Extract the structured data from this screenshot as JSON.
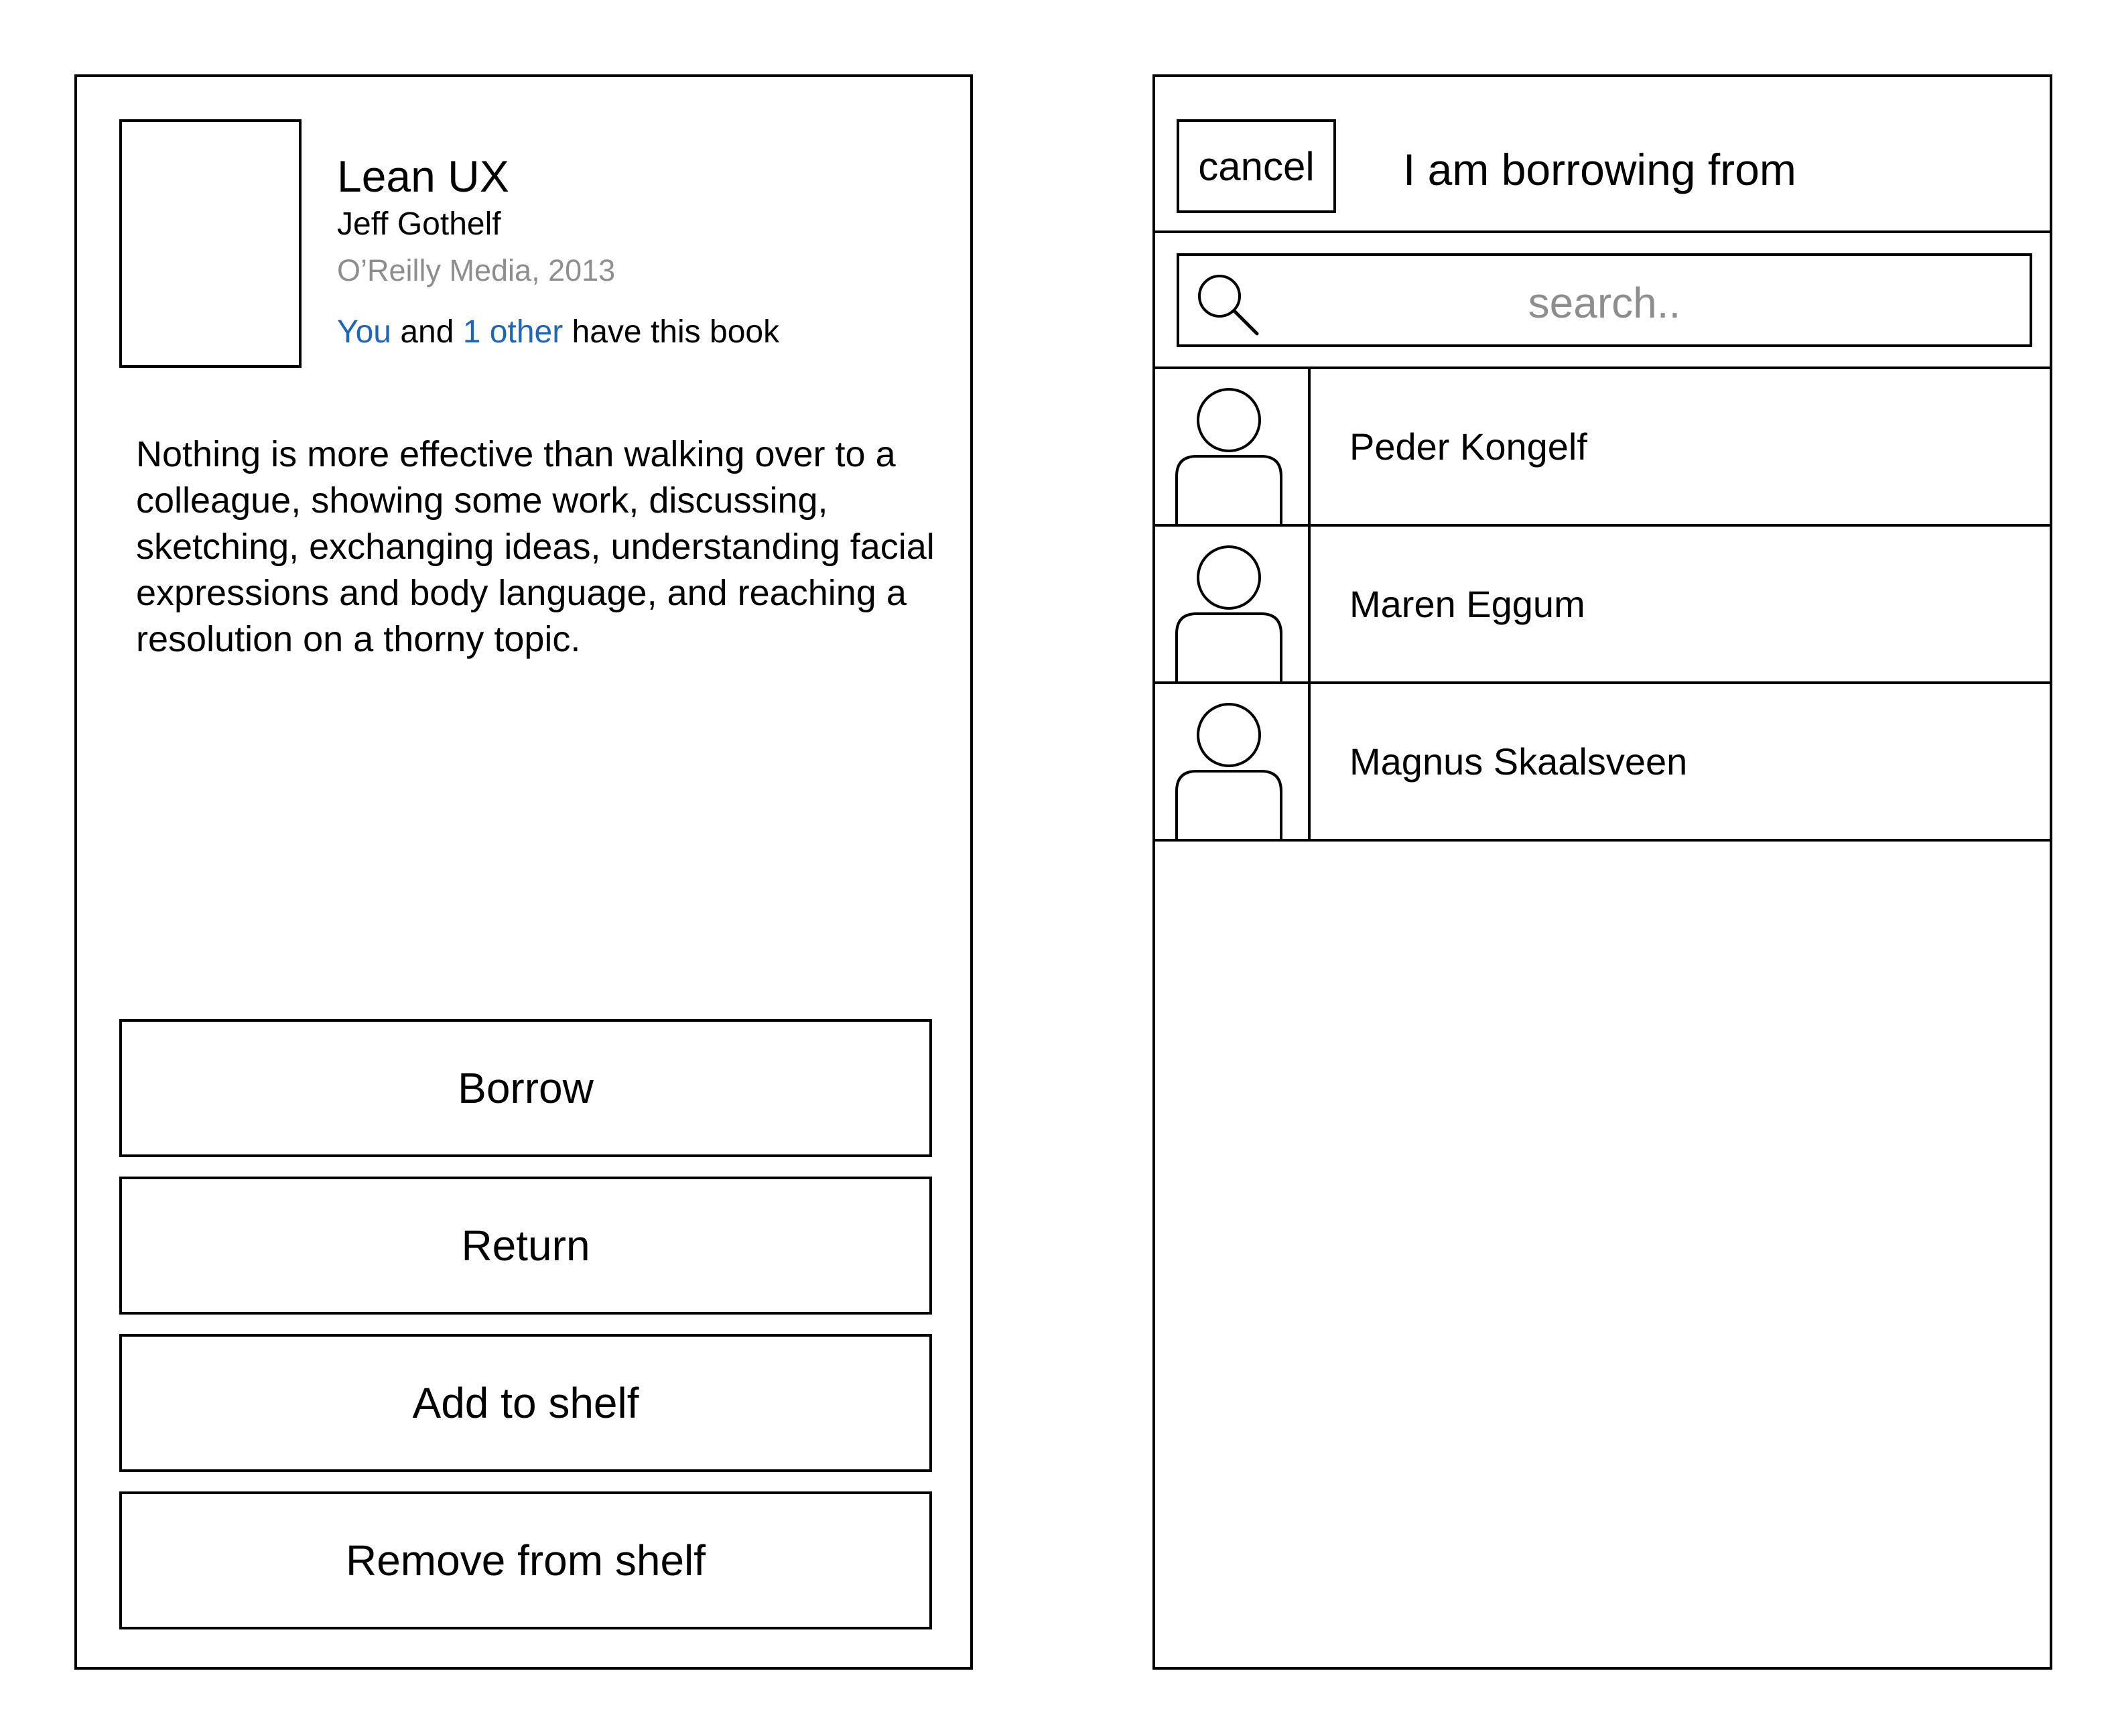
{
  "book": {
    "title": "Lean UX",
    "author": "Jeff Gothelf",
    "publisher": "O’Reilly Media, 2013",
    "owners": {
      "you": "You",
      "and": " and ",
      "other": "1 other",
      "suffix": " have this book"
    },
    "description": "Nothing is more effective than walking over to a colleague, showing some work, discussing, sketching, exchanging ideas, understanding facial expressions and body language, and reaching a resolution on a thorny topic."
  },
  "actions": {
    "borrow": "Borrow",
    "return": "Return",
    "add_to_shelf": "Add to shelf",
    "remove_from_shelf": "Remove from shelf"
  },
  "borrow_sheet": {
    "cancel": "cancel",
    "title": "I am borrowing from",
    "search_placeholder": "search..",
    "people": [
      {
        "name": "Peder Kongelf"
      },
      {
        "name": "Maren Eggum"
      },
      {
        "name": "Magnus Skaalsveen"
      }
    ]
  },
  "colors": {
    "link": "#1f66b8",
    "muted": "#8e8e8e",
    "border": "#000000"
  }
}
